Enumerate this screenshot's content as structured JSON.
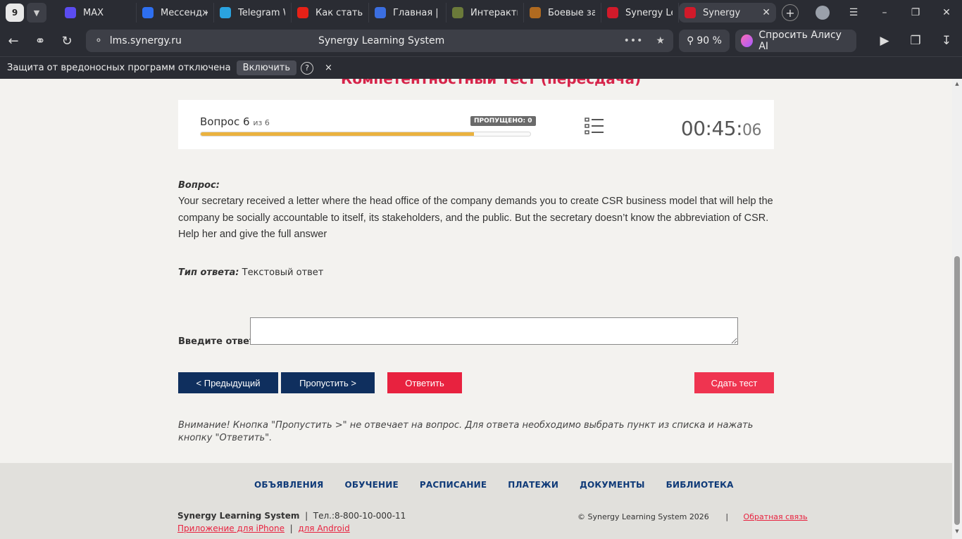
{
  "browser": {
    "tab_count": "9",
    "tabs": [
      {
        "label": "MAX",
        "color": "#5b4cf0"
      },
      {
        "label": "Мессендж",
        "color": "#2e6ff0"
      },
      {
        "label": "Telegram W",
        "color": "#2aa3e0"
      },
      {
        "label": "Как стать (",
        "color": "#e62117"
      },
      {
        "label": "Главная | Н",
        "color": "#3b6ee0"
      },
      {
        "label": "Интеракти",
        "color": "#6b7a3a"
      },
      {
        "label": "Боевые за",
        "color": "#b06a20"
      },
      {
        "label": "Synergy Le",
        "color": "#d11a2a"
      },
      {
        "label": "Synergy",
        "color": "#d11a2a"
      }
    ],
    "url": "lms.synergy.ru",
    "page_title": "Synergy Learning System",
    "zoom": "90 %",
    "alice_label": "Спросить Алису AI",
    "notice_text": "Защита от вредоносных программ отключена",
    "notice_button": "Включить",
    "notice_help": "?",
    "notice_close": "×"
  },
  "test": {
    "title": "Компетентностный тест (пересдача)",
    "question_label": "Вопрос 6",
    "question_of": "из 6",
    "skipped_badge": "ПРОПУЩЕНО: 0",
    "progress_fraction": 0.83,
    "timer_main": "00:45:",
    "timer_sec": "06",
    "question_heading": "Вопрос:",
    "question_text": "Your secretary received a letter where the head office of the company demands you to create CSR business model that will help the company be socially accountable to itself, its stakeholders, and the public. But the secretary doesn’t know the abbreviation of CSR. Help her and give the full answer",
    "answer_type_label": "Тип ответа:",
    "answer_type_value": "Текстовый ответ",
    "answer_label": "Введите ответ:",
    "answer_value": "",
    "buttons": {
      "prev": "< Предыдущий",
      "skip": "Пропустить >",
      "answer": "Ответить",
      "submit": "Сдать тест"
    },
    "warning": "Внимание! Кнопка \"Пропустить >\" не отвечает на вопрос. Для ответа необходимо выбрать пункт из списка и нажать кнопку \"Ответить\"."
  },
  "footer": {
    "nav": [
      "ОБЪЯВЛЕНИЯ",
      "ОБУЧЕНИЕ",
      "РАСПИСАНИЕ",
      "ПЛАТЕЖИ",
      "ДОКУМЕНТЫ",
      "БИБЛИОТЕКА"
    ],
    "brand": "Synergy Learning System",
    "separator": "|",
    "phone": "Тел.:8-800-10-000-11",
    "iphone_link": "Приложение для iPhone",
    "android_link": "для Android",
    "copyright": "© Synergy Learning System 2026",
    "feedback_link": "Обратная связь"
  },
  "colors": {
    "primary_navy": "#0f2f5e",
    "accent_red": "#e8223f",
    "progress_orange": "#eab23f"
  }
}
